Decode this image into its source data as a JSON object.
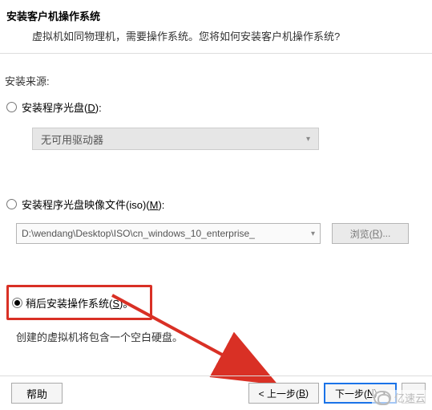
{
  "header": {
    "title": "安装客户机操作系统",
    "subtitle": "虚拟机如同物理机，需要操作系统。您将如何安装客户机操作系统?"
  },
  "source_label": "安装来源:",
  "option1": {
    "label_pre": "安装程序光盘(",
    "label_u": "D",
    "label_post": "):",
    "dropdown": "无可用驱动器"
  },
  "option2": {
    "label_pre": "安装程序光盘映像文件(iso)(",
    "label_u": "M",
    "label_post": "):",
    "iso_path": "D:\\wendang\\Desktop\\ISO\\cn_windows_10_enterprise_",
    "browse_pre": "浏览(",
    "browse_u": "R",
    "browse_post": ")..."
  },
  "option3": {
    "label_pre": "稍后安装操作系统(",
    "label_u": "S",
    "label_post": ")。",
    "desc": "创建的虚拟机将包含一个空白硬盘。"
  },
  "footer": {
    "help": "帮助",
    "back_pre": "< 上一步(",
    "back_u": "B",
    "back_post": ")",
    "next_pre": "下一步(",
    "next_u": "N",
    "next_post": ") >"
  },
  "watermark": "亿速云"
}
